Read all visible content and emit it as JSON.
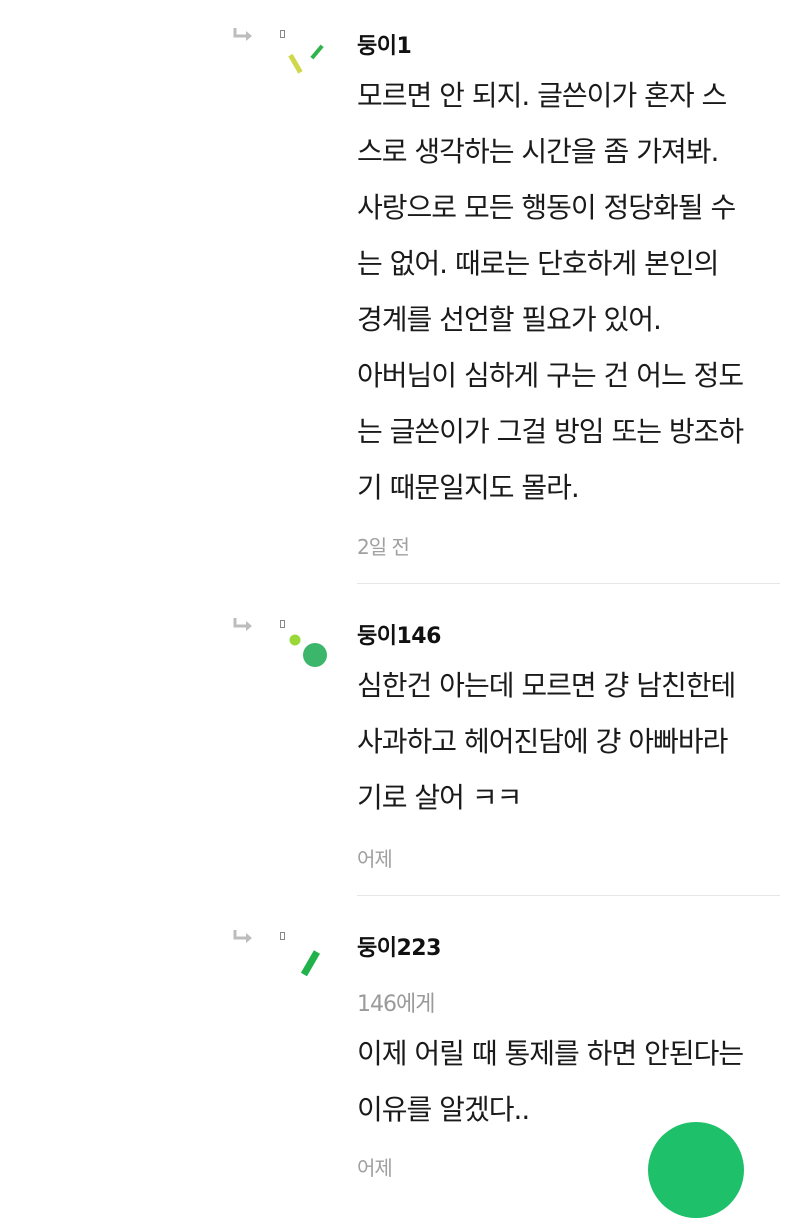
{
  "comments": [
    {
      "author": "둥이1",
      "lines": [
        "모르면 안 되지. 글쓴이가 혼자 스",
        "스로 생각하는 시간을 좀 가져봐.",
        "사랑으로 모든 행동이 정당화될 수",
        "는 없어. 때로는 단호하게 본인의",
        "경계를 선언할 필요가 있어.",
        "아버님이 심하게 구는 건 어느 정도",
        "는 글쓴이가 그걸 방임 또는 방조하",
        "기 때문일지도 몰라."
      ],
      "timestamp": "2일 전",
      "avatar_colors": [
        "#cfd84a",
        "#2fb34a"
      ]
    },
    {
      "author": "둥이146",
      "lines": [
        "심한건 아는데 모르면 걍 남친한테",
        "사과하고 헤어진담에 걍 아빠바라",
        "기로 살어 ㅋㅋ"
      ],
      "timestamp": "어제",
      "avatar_colors": [
        "#9ad83a",
        "#3cb66a"
      ]
    },
    {
      "author": "둥이223",
      "recipient": "146에게",
      "lines": [
        "이제 어릴 때 통제를 하면 안된다는",
        "이유를 알겠다.."
      ],
      "timestamp": "어제",
      "avatar_colors": [
        "#22b24c"
      ]
    }
  ],
  "icons": {
    "reply": "reply-arrow-icon"
  },
  "accent_color": "#1ec06a"
}
